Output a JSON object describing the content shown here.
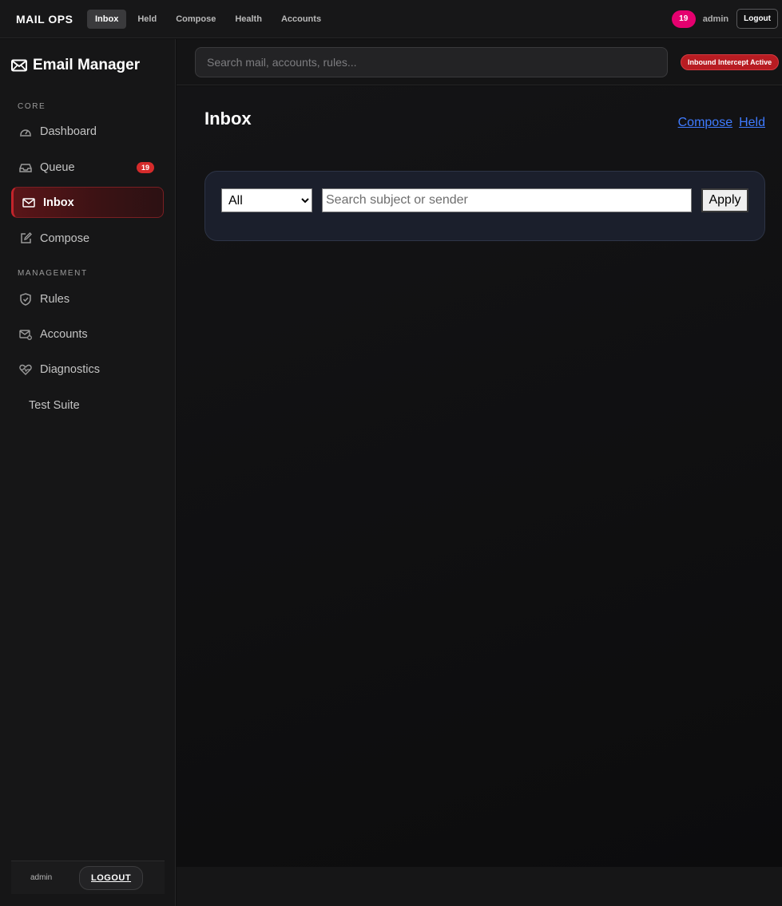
{
  "topbar": {
    "brand": "MAIL OPS",
    "nav": [
      {
        "label": "Inbox",
        "active": true
      },
      {
        "label": "Held",
        "active": false
      },
      {
        "label": "Compose",
        "active": false
      },
      {
        "label": "Health",
        "active": false
      },
      {
        "label": "Accounts",
        "active": false
      }
    ],
    "badge_count": "19",
    "user": "admin",
    "logout_label": "Logout"
  },
  "sidebar": {
    "title": "Email Manager",
    "sections": {
      "core": "CORE",
      "management": "MANAGEMENT"
    },
    "items": [
      {
        "label": "Dashboard",
        "icon": "speedometer-icon"
      },
      {
        "label": "Queue",
        "icon": "inbox-tray-icon",
        "badge": "19"
      },
      {
        "label": "Inbox",
        "icon": "envelope-icon",
        "active": true
      },
      {
        "label": "Compose",
        "icon": "pencil-square-icon"
      },
      {
        "label": "Rules",
        "icon": "shield-check-icon"
      },
      {
        "label": "Accounts",
        "icon": "envelope-gear-icon"
      },
      {
        "label": "Diagnostics",
        "icon": "heart-pulse-icon"
      },
      {
        "label": "Test Suite"
      }
    ],
    "footer": {
      "user": "admin",
      "logout_label": "LOGOUT"
    }
  },
  "header": {
    "search_placeholder": "Search mail, accounts, rules...",
    "intercept_badge": "Inbound Intercept Active"
  },
  "main": {
    "title": "Inbox",
    "links": [
      "Compose",
      "Held"
    ],
    "filter": {
      "select_value": "All",
      "search_placeholder": "Search subject or sender",
      "apply_label": "Apply"
    }
  },
  "colors": {
    "accent_red": "#c3242b",
    "badge_pink": "#e5006f",
    "link_blue": "#3f7bff"
  }
}
